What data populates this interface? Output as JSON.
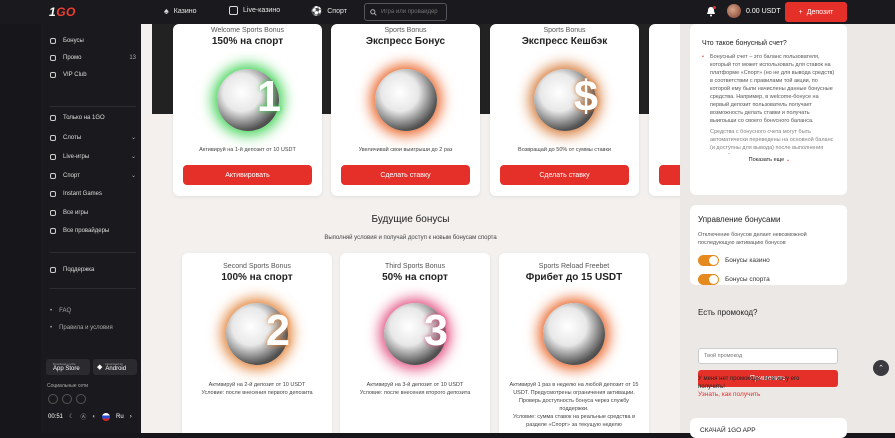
{
  "header": {
    "logo_prefix": "1",
    "logo_suffix": "GO",
    "nav": [
      "Казино",
      "Live-казино",
      "Спорт"
    ],
    "search_placeholder": "Игра или провайдер",
    "balance": "0.00 USDT",
    "deposit_label": "Депозит"
  },
  "sidebar": {
    "items": [
      {
        "label": "Бонусы",
        "count": "",
        "chev": false,
        "icon": "gift-icon"
      },
      {
        "label": "Промо",
        "count": "13",
        "chev": false,
        "icon": "megaphone-icon"
      },
      {
        "label": "VIP Club",
        "count": "",
        "chev": false,
        "icon": "crown-icon"
      },
      {
        "label": "Только на 1GO",
        "count": "",
        "chev": false,
        "icon": "go-icon"
      },
      {
        "label": "Слоты",
        "count": "",
        "chev": true,
        "icon": "slots-icon"
      },
      {
        "label": "Live-игры",
        "count": "",
        "chev": true,
        "icon": "live-icon"
      },
      {
        "label": "Спорт",
        "count": "",
        "chev": true,
        "icon": "ball-icon"
      },
      {
        "label": "Instant Games",
        "count": "",
        "chev": false,
        "icon": "lightning-icon"
      },
      {
        "label": "Все игры",
        "count": "",
        "chev": false,
        "icon": "grid-icon"
      },
      {
        "label": "Все провайдеры",
        "count": "",
        "chev": false,
        "icon": "providers-icon"
      },
      {
        "label": "Поддержка",
        "count": "",
        "chev": false,
        "icon": "support-icon"
      }
    ],
    "faq": "FAQ",
    "rules": "Правила и условия",
    "appstore_top": "Download on the",
    "appstore": "App Store",
    "android_top": "Download for",
    "android": "Android",
    "social_label": "Социальные сети",
    "time": "00:51",
    "lang": "Ru"
  },
  "active_bonuses": [
    {
      "sub": "Welcome Sports Bonus",
      "title": "150% на спорт",
      "desc": "Активируй на 1-й депозит от 10 USDT",
      "button": "Активировать",
      "num": "1"
    },
    {
      "sub": "Sports Bonus",
      "title": "Экспресс Бонус",
      "desc": "Увеличивай свои выигрыши до 2 раз",
      "button": "Сделать ставку",
      "num": ""
    },
    {
      "sub": "Sports Bonus",
      "title": "Экспресс Кешбэк",
      "desc": "Возвращай до 50% от суммы ставки",
      "button": "Сделать ставку",
      "num": "$"
    }
  ],
  "future": {
    "heading": "Будущие бонусы",
    "subheading": "Выполняй условия и получай доступ к новым бонусам спорта",
    "cards": [
      {
        "sub": "Second Sports Bonus",
        "title": "100% на спорт",
        "desc1": "Активируй на 2-й депозит от 10 USDT",
        "desc2": "Условие: после внесения первого депозита",
        "num": "2"
      },
      {
        "sub": "Third Sports Bonus",
        "title": "50% на спорт",
        "desc1": "Активируй на 3-й депозит от 10 USDT",
        "desc2": "Условие: после внесения второго депозита",
        "num": "3"
      },
      {
        "sub": "Sports Reload Freebet",
        "title": "Фрибет до 15 USDT",
        "desc1": "Активируй 1 раз в неделю на любой депозит от 15 USDT. Предусмотрены ограничения активации. Проверь доступность бонуса через службу поддержки.",
        "desc2": "Условие: сумма ставок на реальные средства в разделе «Спорт» за текущую неделю",
        "num": ""
      }
    ]
  },
  "right": {
    "q_title": "Что такое бонусный счет?",
    "q_text1": "Бонусный счет – это баланс пользователя, который тот может использовать для ставок на платформе «Спорт» (но не для вывода средств) в соответствии с правилами той акции, по которой ему были начислены данные бонусные средства. Например, в welcome-бонусе на первый депозит пользователь получает возможность делать ставки и получать выигрыши со своего бонусного баланса.",
    "q_text2": "Средства с бонусного счета могут быть автоматически переведены на основной баланс (и доступны для вывода) после выполнения условий отыгрыша.",
    "show_more": "Показать еще",
    "manage_title": "Управление бонусами",
    "manage_text": "Отключение бонусов делает невозможной последующую активацию бонусов",
    "toggle_casino": "Бонусы казино",
    "toggle_sport": "Бонусы спорта",
    "promo_title": "Есть промокод?",
    "promo_placeholder": "Твой промокод",
    "promo_button": "Применить",
    "no_promo": "У меня нет промокода, но я хочу его получить!",
    "how_link": "Узнать, как получить",
    "download": "СКАЧАЙ 1GO APP"
  },
  "colors": {
    "accent": "#e5302a",
    "toggle": "#e58a1e",
    "dark": "#1a1a1e"
  }
}
